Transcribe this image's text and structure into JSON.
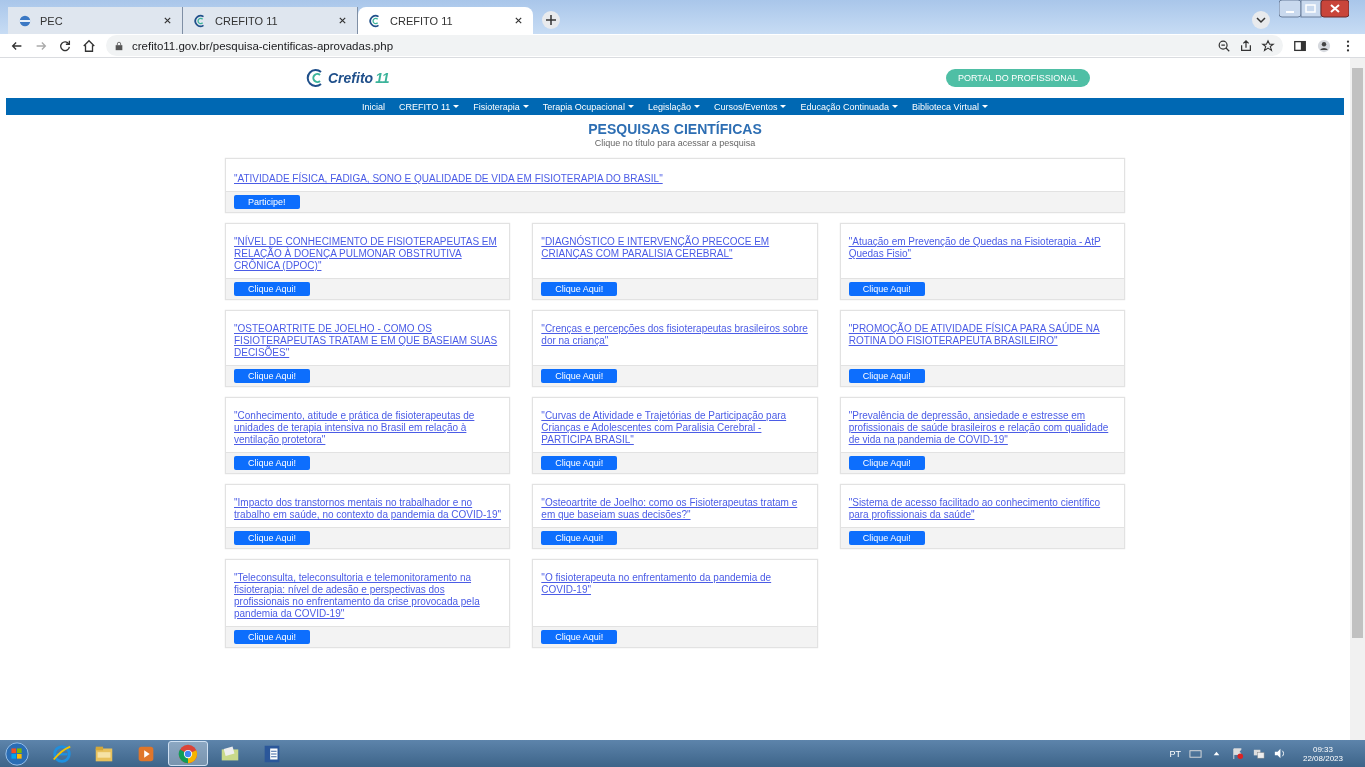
{
  "browser": {
    "tabs": [
      {
        "title": "PEC",
        "selected": false
      },
      {
        "title": "CREFITO 11",
        "selected": false
      },
      {
        "title": "CREFITO 11",
        "selected": true
      }
    ],
    "url": "crefito11.gov.br/pesquisa-cientificas-aprovadas.php"
  },
  "header": {
    "logo_text": "Crefito",
    "logo_number": "11",
    "portal_button": "PORTAL DO PROFISSIONAL"
  },
  "nav": [
    {
      "label": "Inicial",
      "dropdown": false
    },
    {
      "label": "CREFITO 11",
      "dropdown": true
    },
    {
      "label": "Fisioterapia",
      "dropdown": true
    },
    {
      "label": "Terapia Ocupacional",
      "dropdown": true
    },
    {
      "label": "Legislação",
      "dropdown": true
    },
    {
      "label": "Cursos/Eventos",
      "dropdown": true
    },
    {
      "label": "Educação Continuada",
      "dropdown": true
    },
    {
      "label": "Biblioteca Virtual",
      "dropdown": true
    }
  ],
  "page": {
    "title": "PESQUISAS CIENTÍFICAS",
    "subtitle": "Clique no título para acessar a pesquisa"
  },
  "featured": {
    "title": "\"ATIVIDADE FÍSICA, FADIGA, SONO E QUALIDADE DE VIDA EM FISIOTERAPIA DO BRASIL\"",
    "button": "Participe!"
  },
  "cards": [
    {
      "title": "\"NÍVEL DE CONHECIMENTO DE FISIOTERAPEUTAS EM RELAÇÃO À DOENÇA PULMONAR OBSTRUTIVA CRÔNICA (DPOC)\"",
      "button": "Clique Aqui!"
    },
    {
      "title": "\"DIAGNÓSTICO E INTERVENÇÃO PRECOCE EM CRIANÇAS COM PARALISIA CEREBRAL\"",
      "button": "Clique Aqui!"
    },
    {
      "title": "\"Atuação em Prevenção de Quedas na Fisioterapia - AtP Quedas Fisio\"",
      "button": "Clique Aqui!"
    },
    {
      "title": "\"OSTEOARTRITE DE JOELHO - COMO OS FISIOTERAPEUTAS TRATAM E EM QUE BASEIAM SUAS DECISÕES\"",
      "button": "Clique Aqui!"
    },
    {
      "title": "\"Crenças e percepções dos fisioterapeutas brasileiros sobre dor na criança\"",
      "button": "Clique Aqui!"
    },
    {
      "title": "\"PROMOÇÃO DE ATIVIDADE FÍSICA PARA SAÚDE NA ROTINA DO FISIOTERAPEUTA BRASILEIRO\"",
      "button": "Clique Aqui!"
    },
    {
      "title": "\"Conhecimento, atitude e prática de fisioterapeutas de unidades de terapia intensiva no Brasil em relação à ventilação protetora\"",
      "button": "Clique Aqui!"
    },
    {
      "title": "\"Curvas de Atividade e Trajetórias de Participação para Crianças e Adolescentes com Paralisia Cerebral - PARTICIPA BRASIL\"",
      "button": "Clique Aqui!"
    },
    {
      "title": "\"Prevalência de depressão, ansiedade e estresse em profissionais de saúde brasileiros e relação com qualidade de vida na pandemia de COVID-19\"",
      "button": "Clique Aqui!"
    },
    {
      "title": "\"Impacto dos transtornos mentais no trabalhador e no trabalho em saúde, no contexto da pandemia da COVID-19\"",
      "button": "Clique Aqui!"
    },
    {
      "title": "\"Osteoartrite de Joelho: como os Fisioterapeutas tratam e em que baseiam suas decisões?\"",
      "button": "Clique Aqui!"
    },
    {
      "title": "\"Sistema de acesso facilitado ao conhecimento científico para profissionais da saúde\"",
      "button": "Clique Aqui!"
    },
    {
      "title": "\"Teleconsulta, teleconsultoria e telemonitoramento na fisioterapia: nível de adesão e perspectivas dos profissionais no enfrentamento da crise provocada pela pandemia da COVID-19\"",
      "button": "Clique Aqui!"
    },
    {
      "title": "\"O fisioterapeuta no enfrentamento da pandemia de COVID-19\"",
      "button": "Clique Aqui!"
    }
  ],
  "taskbar": {
    "apps": [
      {
        "kind": "ie",
        "selected": false
      },
      {
        "kind": "folder",
        "selected": false
      },
      {
        "kind": "media",
        "selected": false
      },
      {
        "kind": "chrome",
        "selected": true
      },
      {
        "kind": "folder2",
        "selected": false
      },
      {
        "kind": "word",
        "selected": false
      }
    ],
    "language": "PT",
    "time": "09:33",
    "date": "22/08/2023"
  }
}
